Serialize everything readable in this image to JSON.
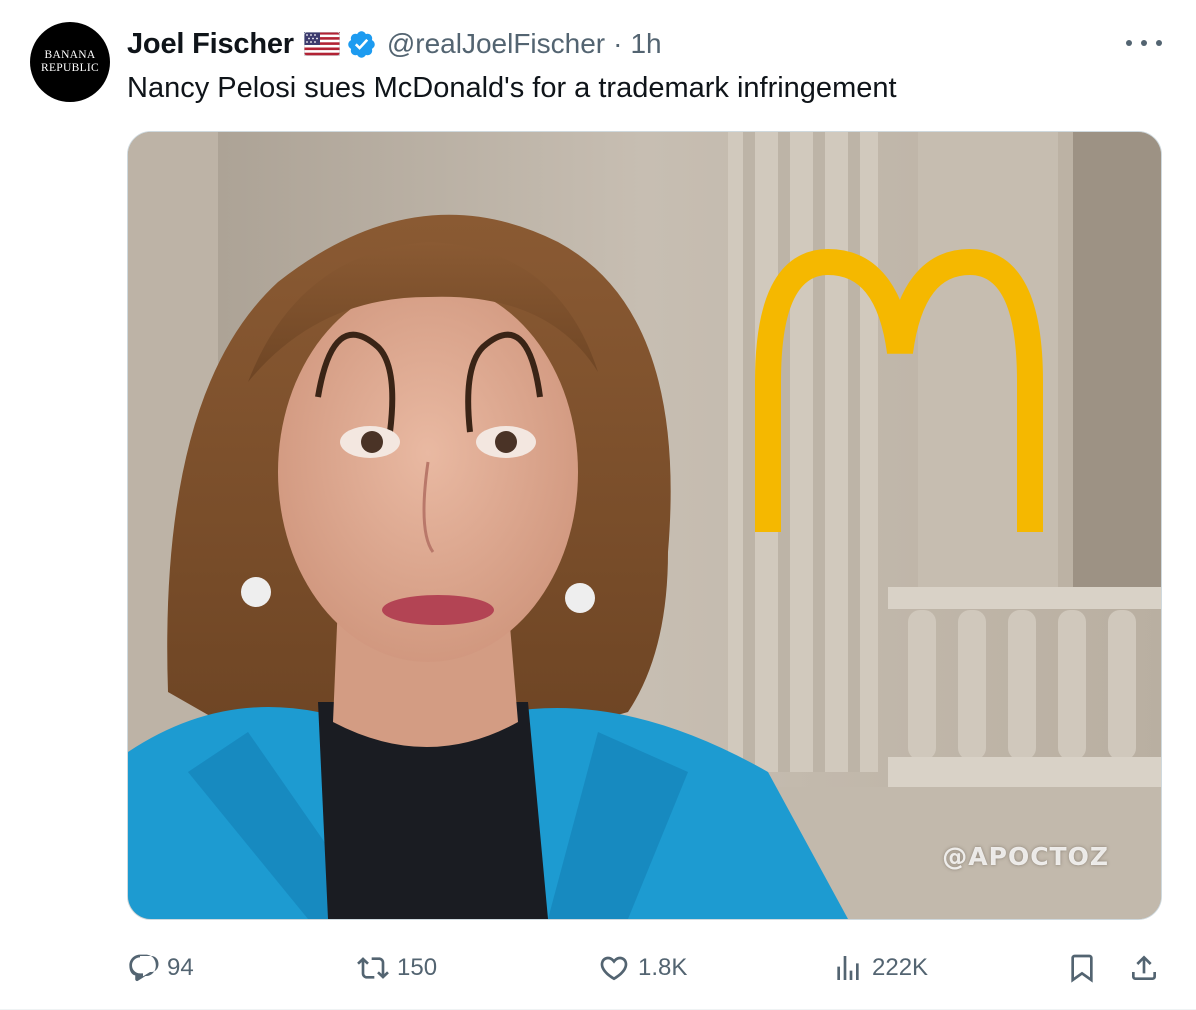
{
  "author": {
    "avatar_text_line1": "BANANA",
    "avatar_text_line2": "REPUBLIC",
    "name": "Joel Fischer",
    "handle": "@realJoelFischer",
    "separator": "·",
    "time": "1h",
    "flag_icon": "us-flag-icon",
    "verified_icon": "verified-badge-icon"
  },
  "tweet_text": "Nancy Pelosi sues McDonald's for a trademark infringement",
  "media": {
    "watermark": "@APOCTOZ",
    "logo_color": "#f5b800",
    "jacket_color": "#1d9bd1"
  },
  "actions": {
    "replies": "94",
    "reposts": "150",
    "likes": "1.8K",
    "views": "222K"
  },
  "colors": {
    "text": "#0f1419",
    "secondary": "#536471",
    "verified": "#1d9bf0",
    "border": "#cfd9de"
  }
}
